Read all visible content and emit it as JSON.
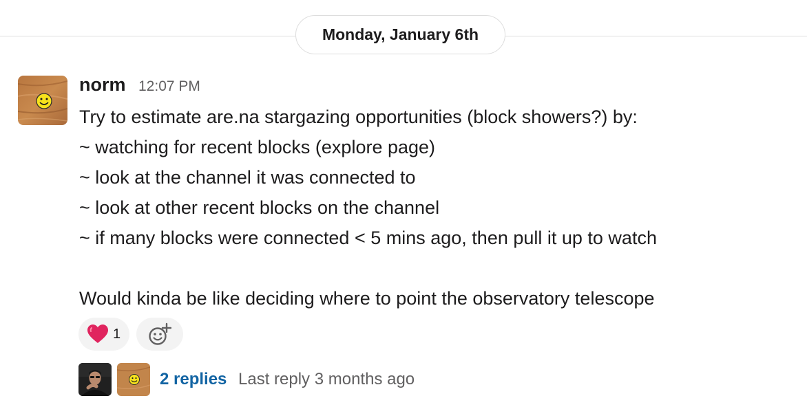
{
  "date_divider": {
    "label": "Monday, January 6th"
  },
  "message": {
    "sender": "norm",
    "time": "12:07 PM",
    "lines": [
      "Try to estimate are.na stargazing opportunities (block showers?) by:",
      "~ watching for recent blocks (explore page)",
      "~ look at the channel it was connected to",
      "~ look at other recent blocks on the channel",
      "~ if many blocks were connected < 5 mins ago, then pull it up to watch",
      "",
      "Would kinda be like deciding where to point the observatory telescope"
    ],
    "avatar_icon": "smiley-face-on-wood"
  },
  "reactions": [
    {
      "emoji": "heart",
      "count": "1"
    }
  ],
  "add_reaction": {
    "icon": "add-emoji-icon"
  },
  "thread": {
    "replies_label": "2 replies",
    "last_reply": "Last reply 3 months ago"
  },
  "colors": {
    "link": "#1264a3",
    "muted_text": "#616061",
    "divider": "#dddddd",
    "reaction_bg": "#f3f3f3",
    "heart": "#e0245e"
  }
}
